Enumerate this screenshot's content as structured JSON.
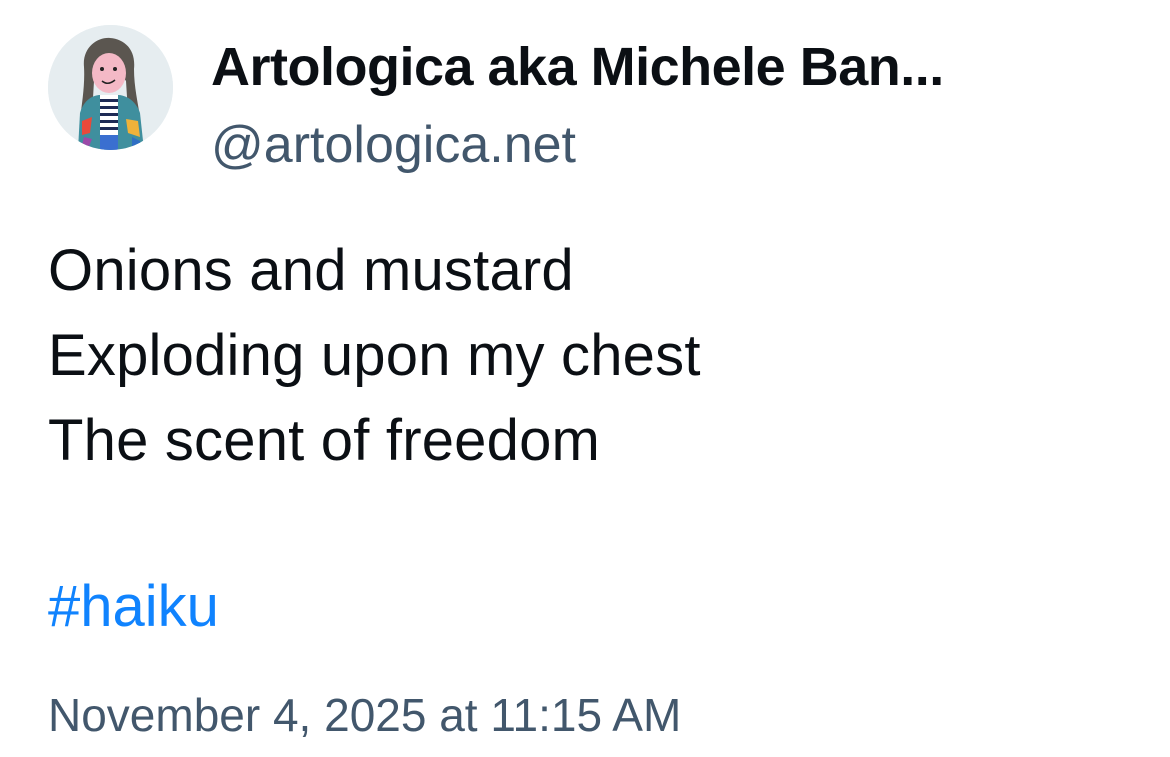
{
  "author": {
    "display_name": "Artologica aka Michele Ban...",
    "handle": "@artologica.net",
    "avatar": "avatar-drawing-person-icon"
  },
  "post": {
    "lines": [
      "Onions and mustard",
      "Exploding upon my chest",
      "The scent of freedom"
    ],
    "hashtag": "#haiku",
    "timestamp": "November 4, 2025 at 11:15 AM"
  },
  "colors": {
    "text": "#0b0f14",
    "secondary": "#42576c",
    "link": "#1083fe",
    "background": "#ffffff"
  }
}
